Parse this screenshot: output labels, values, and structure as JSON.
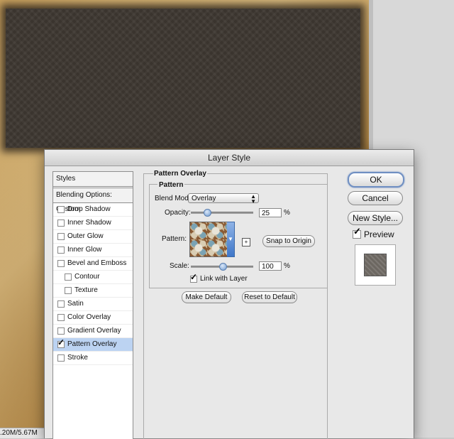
{
  "window": {
    "title": "Layer Style"
  },
  "status_bar": {
    "text": ".20M/5.67M"
  },
  "styles_list": {
    "header": "Styles",
    "blending_options": "Blending Options: Custom",
    "items": [
      {
        "label": "Drop Shadow",
        "checked": false,
        "indent": false,
        "selected": false
      },
      {
        "label": "Inner Shadow",
        "checked": false,
        "indent": false,
        "selected": false
      },
      {
        "label": "Outer Glow",
        "checked": false,
        "indent": false,
        "selected": false
      },
      {
        "label": "Inner Glow",
        "checked": false,
        "indent": false,
        "selected": false
      },
      {
        "label": "Bevel and Emboss",
        "checked": false,
        "indent": false,
        "selected": false
      },
      {
        "label": "Contour",
        "checked": false,
        "indent": true,
        "selected": false
      },
      {
        "label": "Texture",
        "checked": false,
        "indent": true,
        "selected": false
      },
      {
        "label": "Satin",
        "checked": false,
        "indent": false,
        "selected": false
      },
      {
        "label": "Color Overlay",
        "checked": false,
        "indent": false,
        "selected": false
      },
      {
        "label": "Gradient Overlay",
        "checked": false,
        "indent": false,
        "selected": false
      },
      {
        "label": "Pattern Overlay",
        "checked": true,
        "indent": false,
        "selected": true
      },
      {
        "label": "Stroke",
        "checked": false,
        "indent": false,
        "selected": false
      }
    ]
  },
  "pattern_overlay": {
    "group_title": "Pattern Overlay",
    "sub_title": "Pattern",
    "blend_mode_label": "Blend Mode:",
    "blend_mode_value": "Overlay",
    "opacity_label": "Opacity:",
    "opacity_value": "25",
    "opacity_unit": "%",
    "opacity_fraction": 0.25,
    "pattern_label": "Pattern:",
    "snap_to_origin": "Snap to Origin",
    "scale_label": "Scale:",
    "scale_value": "100",
    "scale_unit": "%",
    "link_with_layer": "Link with Layer",
    "link_with_layer_checked": true,
    "make_default": "Make Default",
    "reset_to_default": "Reset to Default"
  },
  "buttons": {
    "ok": "OK",
    "cancel": "Cancel",
    "new_style": "New Style..."
  },
  "preview": {
    "label": "Preview",
    "checked": true
  }
}
